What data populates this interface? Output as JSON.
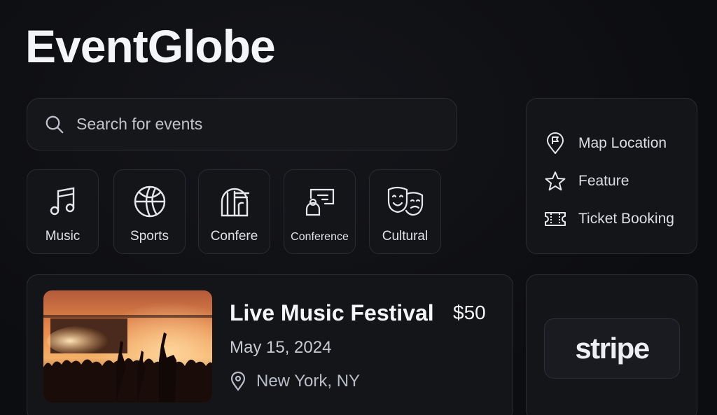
{
  "app": {
    "title": "EventGlobe"
  },
  "search": {
    "placeholder": "Search for events",
    "icon": "search-icon"
  },
  "categories": [
    {
      "label": "Music",
      "icon": "music-note-icon"
    },
    {
      "label": "Sports",
      "icon": "basketball-icon"
    },
    {
      "label": "Confere",
      "icon": "conference-building-icon"
    },
    {
      "label": "Conference",
      "icon": "presentation-board-icon"
    },
    {
      "label": "Cultural",
      "icon": "theater-masks-icon"
    }
  ],
  "side_menu": [
    {
      "label": "Map Location",
      "icon": "map-pin-icon"
    },
    {
      "label": "Feature",
      "icon": "star-icon"
    },
    {
      "label": "Ticket Booking",
      "icon": "ticket-icon"
    }
  ],
  "event": {
    "title": "Live Music Festival",
    "price": "$50",
    "date": "May 15, 2024",
    "location": "New York, NY"
  },
  "payment": {
    "provider": "stripe"
  },
  "colors": {
    "background": "#0d0e11",
    "card": "#141519",
    "border": "#2a2c32",
    "text": "#e8e9ee"
  }
}
